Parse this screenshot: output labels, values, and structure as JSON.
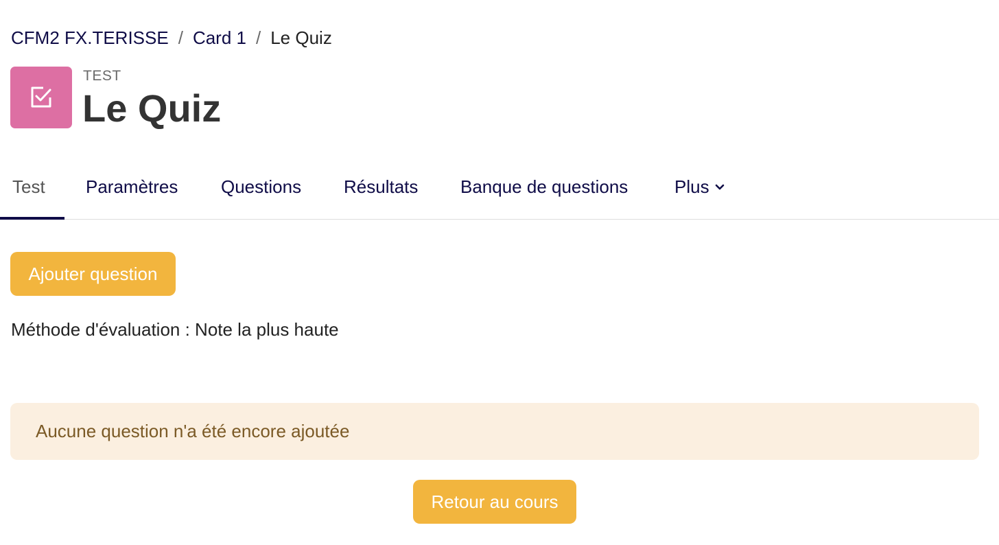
{
  "breadcrumb": {
    "course": "CFM2 FX.TERISSE",
    "section": "Card 1",
    "current": "Le Quiz",
    "separator": "/"
  },
  "header": {
    "icon": "checkbox-icon",
    "icon_color": "#dd6fa3",
    "activity_type": "TEST",
    "title": "Le Quiz"
  },
  "tabs": [
    {
      "label": "Test",
      "active": true
    },
    {
      "label": "Paramètres",
      "active": false
    },
    {
      "label": "Questions",
      "active": false
    },
    {
      "label": "Résultats",
      "active": false
    },
    {
      "label": "Banque de questions",
      "active": false
    },
    {
      "label": "Plus",
      "active": false,
      "icon": "chevron-down-icon"
    }
  ],
  "main": {
    "add_question_label": "Ajouter question",
    "grading_method": "Méthode d'évaluation : Note la plus haute",
    "no_questions_message": "Aucune question n'a été encore ajoutée",
    "back_to_course_label": "Retour au cours"
  },
  "colors": {
    "accent": "#f2b53e",
    "nav_text": "#0f0c47",
    "alert_background": "#fbefe0",
    "alert_text": "#7b5a26"
  }
}
